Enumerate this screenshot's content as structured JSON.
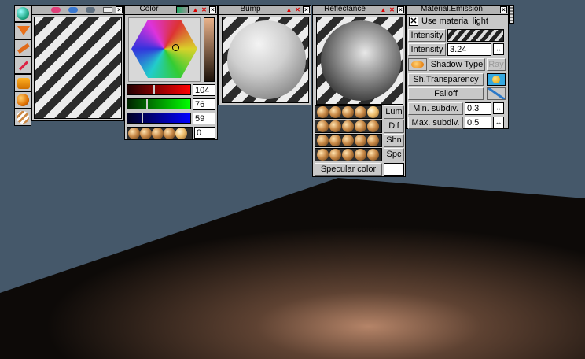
{
  "colors": {
    "desktop": "#45586a",
    "panel": "#c8c8c8",
    "title_bg": "#b4b4b4",
    "close_red": "#dd0000"
  },
  "panels": {
    "texture": {
      "title": ""
    },
    "color": {
      "title": "Color",
      "red": "104",
      "green": "76",
      "blue": "59",
      "extra": "0"
    },
    "bump": {
      "title": "Bump"
    },
    "reflectance": {
      "title": "Reflectance",
      "lum": "Lum",
      "dif": "Dif",
      "shn": "Shn",
      "spc": "Spc",
      "specular_color": "Specular color"
    },
    "emission": {
      "title": "Material.Emission",
      "use_material_light": "Use material light",
      "intensity_label": "Intensity",
      "intensity_value_label": "Intensity",
      "intensity_value": "3.24",
      "shadow_type": "Shadow Type",
      "ray": "Ray",
      "sh_transparency": "Sh.Transparency",
      "falloff": "Falloff",
      "min_subdiv_label": "Min. subdiv.",
      "min_subdiv_value": "0.3",
      "max_subdiv_label": "Max. subdiv.",
      "max_subdiv_value": "0.5"
    }
  },
  "icons": {
    "close": "close-x",
    "minimize": "triangle-up",
    "arrows": "double-arrow"
  }
}
